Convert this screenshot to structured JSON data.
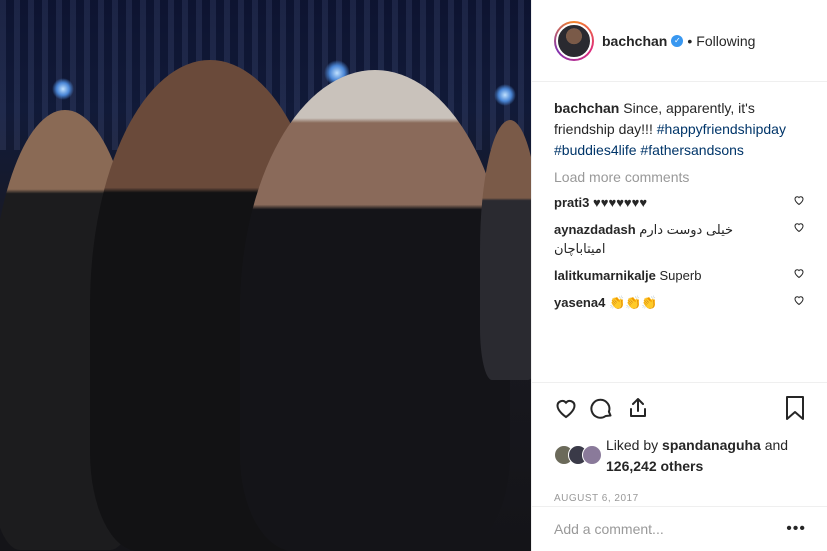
{
  "post": {
    "username": "bachchan",
    "follow_status": "Following",
    "separator": "•",
    "verified_icon": "verified-badge-icon",
    "caption_user": "bachchan",
    "caption_text": "Since, apparently, it's friendship day!!!",
    "hashtags": [
      "#happyfriendshipday",
      "#buddies4life",
      "#fathersandsons"
    ],
    "load_more": "Load more comments",
    "comments": [
      {
        "user": "prati3",
        "text": "♥♥♥♥♥♥♥"
      },
      {
        "user": "aynazdadash",
        "text": "خیلی دوست دارم امیتاباچان"
      },
      {
        "user": "lalitkumarnikalje",
        "text": "Superb"
      },
      {
        "user": "yasena4",
        "text": "👏👏👏"
      }
    ],
    "likes_prefix": "Liked by",
    "likes_user": "spandanaguha",
    "likes_and": "and",
    "likes_count": "126,242 others",
    "date": "AUGUST 6, 2017",
    "add_comment_placeholder": "Add a comment...",
    "more_options": "•••"
  },
  "colors": {
    "text": "#262626",
    "muted": "#999999",
    "hashtag": "#003569",
    "verified": "#3897f0",
    "border": "#efefef"
  },
  "icons": [
    "heart-icon",
    "comment-icon",
    "share-icon",
    "bookmark-icon",
    "comment-like-heart-icon",
    "verified-badge-icon"
  ]
}
